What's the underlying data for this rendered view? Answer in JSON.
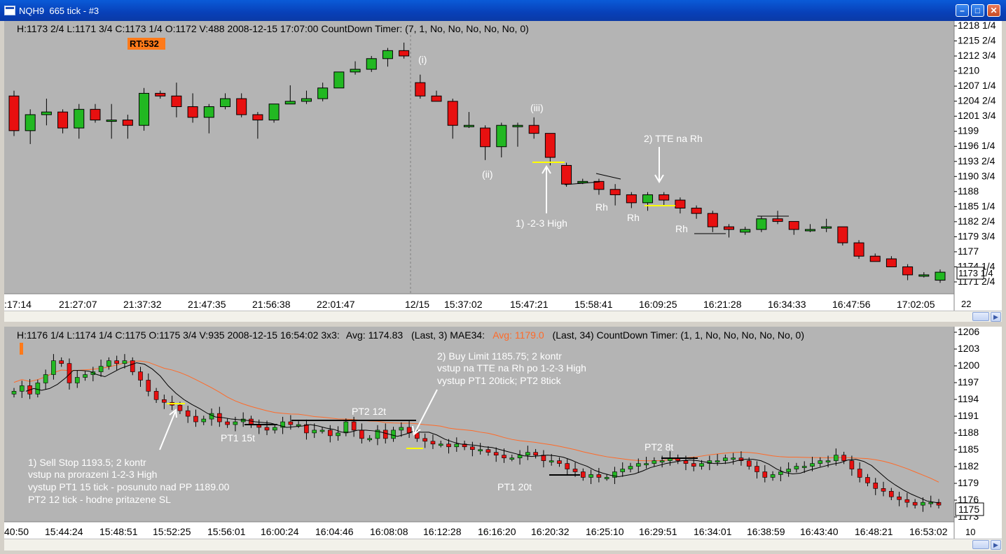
{
  "window": {
    "title": "NQH9  665 tick - #3",
    "buttons": [
      "minimize",
      "maximize",
      "close"
    ]
  },
  "chart_data": [
    {
      "type": "candlestick",
      "header": "H:1173 2/4  L:1171 3/4  C:1173 1/4  O:1172  V:488  2008-12-15  17:07:00  CountDown Timer:   (7, 1, No, No, No, No, No, 0)",
      "badge": "RT:532",
      "price_axis": [
        "1218 1/4",
        "1215 2/4",
        "1212 3/4",
        "1210",
        "1207 1/4",
        "1204 2/4",
        "1201 3/4",
        "1199",
        "1196 1/4",
        "1193 2/4",
        "1190 3/4",
        "1188",
        "1185 1/4",
        "1182 2/4",
        "1179 3/4",
        "1177",
        "1174 1/4",
        "1171 2/4"
      ],
      "y_range": [
        1170.5,
        1219.5
      ],
      "last_price": "1173 1/4",
      "time_axis": [
        ":17:14",
        "21:27:07",
        "21:37:32",
        "21:47:35",
        "21:56:38",
        "22:01:47",
        "12/15",
        "15:37:02",
        "15:47:21",
        "15:58:41",
        "16:09:25",
        "16:21:28",
        "16:34:33",
        "16:47:56",
        "17:02:05"
      ],
      "axis_corner": "22",
      "candles": [
        [
          1206.5,
          1207.5,
          1199.0,
          1200.0
        ],
        [
          1200.0,
          1204.0,
          1197.5,
          1203.0
        ],
        [
          1203.0,
          1206.0,
          1201.0,
          1203.5
        ],
        [
          1203.5,
          1204.0,
          1199.5,
          1200.5
        ],
        [
          1200.5,
          1205.0,
          1198.5,
          1204.0
        ],
        [
          1204.0,
          1205.0,
          1201.5,
          1202.0
        ],
        [
          1202.0,
          1205.0,
          1198.5,
          1202.0
        ],
        [
          1202.0,
          1203.0,
          1198.5,
          1201.0
        ],
        [
          1201.0,
          1208.0,
          1200.0,
          1207.0
        ],
        [
          1207.0,
          1207.5,
          1206.0,
          1206.5
        ],
        [
          1206.5,
          1209.0,
          1202.5,
          1204.5
        ],
        [
          1204.5,
          1207.0,
          1201.5,
          1202.5
        ],
        [
          1202.5,
          1205.0,
          1199.5,
          1204.5
        ],
        [
          1204.5,
          1207.0,
          1204.0,
          1206.0
        ],
        [
          1206.0,
          1207.0,
          1202.5,
          1203.0
        ],
        [
          1203.0,
          1203.5,
          1198.5,
          1202.0
        ],
        [
          1202.0,
          1205.0,
          1201.5,
          1205.0
        ],
        [
          1205.0,
          1208.5,
          1205.0,
          1205.5
        ],
        [
          1205.5,
          1207.5,
          1205.0,
          1206.0
        ],
        [
          1206.0,
          1209.0,
          1205.5,
          1208.0
        ],
        [
          1208.0,
          1211.0,
          1208.0,
          1211.0
        ],
        [
          1211.0,
          1213.0,
          1210.5,
          1211.5
        ],
        [
          1211.5,
          1214.0,
          1211.0,
          1213.5
        ],
        [
          1213.5,
          1215.5,
          1212.0,
          1215.0
        ],
        [
          1215.0,
          1216.5,
          1213.5,
          1214.0
        ],
        [
          1209.0,
          1210.5,
          1206.0,
          1206.5
        ],
        [
          1206.5,
          1207.5,
          1205.5,
          1205.5
        ],
        [
          1205.5,
          1206.0,
          1198.5,
          1201.0
        ],
        [
          1201.0,
          1203.5,
          1200.5,
          1201.0
        ],
        [
          1200.5,
          1201.0,
          1194.5,
          1197.0
        ],
        [
          1197.0,
          1201.5,
          1195.0,
          1201.0
        ],
        [
          1201.0,
          1201.5,
          1197.0,
          1201.0
        ],
        [
          1201.0,
          1202.5,
          1198.5,
          1199.5
        ],
        [
          1199.5,
          1199.5,
          1193.5,
          1195.0
        ],
        [
          1193.5,
          1194.0,
          1189.5,
          1190.0
        ],
        [
          1190.5,
          1191.0,
          1190.0,
          1190.5
        ],
        [
          1190.5,
          1191.0,
          1188.0,
          1189.0
        ],
        [
          1189.0,
          1190.0,
          1186.0,
          1188.0
        ],
        [
          1188.0,
          1188.5,
          1185.5,
          1186.5
        ],
        [
          1186.5,
          1188.5,
          1185.0,
          1188.0
        ],
        [
          1188.0,
          1188.5,
          1186.0,
          1187.0
        ],
        [
          1187.0,
          1187.5,
          1184.5,
          1185.5
        ],
        [
          1185.5,
          1186.0,
          1183.5,
          1184.5
        ],
        [
          1184.5,
          1185.0,
          1181.0,
          1182.0
        ],
        [
          1182.0,
          1182.5,
          1180.0,
          1181.5
        ],
        [
          1181.0,
          1182.0,
          1180.5,
          1181.5
        ],
        [
          1181.5,
          1184.0,
          1181.0,
          1183.5
        ],
        [
          1183.5,
          1185.0,
          1182.5,
          1183.0
        ],
        [
          1183.0,
          1183.0,
          1180.5,
          1181.5
        ],
        [
          1181.5,
          1182.5,
          1181.0,
          1181.5
        ],
        [
          1182.0,
          1183.5,
          1181.0,
          1182.0
        ],
        [
          1182.0,
          1182.0,
          1178.5,
          1179.0
        ],
        [
          1179.0,
          1179.5,
          1176.0,
          1176.5
        ],
        [
          1176.5,
          1177.0,
          1175.5,
          1175.5
        ],
        [
          1176.0,
          1176.5,
          1174.5,
          1174.5
        ],
        [
          1174.5,
          1175.0,
          1172.0,
          1173.0
        ],
        [
          1173.0,
          1173.5,
          1172.5,
          1173.0
        ],
        [
          1172.0,
          1174.0,
          1171.5,
          1173.5
        ]
      ],
      "annotations": [
        "(i)",
        "(iii)",
        "(ii)",
        "2) TTE na Rh",
        "1) -2-3 High",
        "Rh",
        "Rh",
        "Rh"
      ],
      "ylim": [
        1170.5,
        1219.5
      ]
    },
    {
      "type": "candlestick",
      "header_parts": [
        "H:1176 1/4  L:1174 1/4  C:1175  O:1175 3/4  V:935  2008-12-15  16:54:02  3x3:",
        "Avg: 1174.83",
        "(Last, 3)  MAE34:",
        "Avg: 1179.0",
        "(Last, 34)  CountDown Timer:   (1, 1, No, No, No, No, No, 0)"
      ],
      "price_axis": [
        "1206",
        "1203",
        "1200",
        "1197",
        "1194",
        "1191",
        "1188",
        "1185",
        "1182",
        "1179",
        "1176",
        "1173"
      ],
      "last_price": "1175",
      "time_axis": [
        "40:50",
        "15:44:24",
        "15:48:51",
        "15:52:25",
        "15:56:01",
        "16:00:24",
        "16:04:46",
        "16:08:08",
        "16:12:28",
        "16:16:20",
        "16:20:32",
        "16:25:10",
        "16:29:51",
        "16:34:01",
        "16:38:59",
        "16:43:40",
        "16:48:21",
        "16:53:02"
      ],
      "axis_corner": "10",
      "y_range": [
        1172.5,
        1206.5
      ],
      "annotations": [
        "2) Buy Limit 1185.75; 2 kontr",
        "vstup na TTE na Rh po 1-2-3 High",
        "vystup PT1 20tick; PT2 8tick",
        "PT2 12t",
        "PT1 15t",
        "PT2 8t",
        "PT1 20t",
        "1) Sell Stop 1193.5; 2 kontr",
        "vstup na prorazeni 1-2-3 High",
        "vystup PT1 15 tick - posunuto nad PP 1189.00",
        "PT2 12 tick - hodne pritazene SL"
      ],
      "ylim": [
        1172.5,
        1206.5
      ]
    }
  ],
  "colors": {
    "background": "#b4b4b4",
    "up": "#22b822",
    "down": "#e81010",
    "ma_slow": "#ff6a28",
    "ma_fast": "#000000",
    "marker": "#ffff00",
    "badge_bg": "#ff7a1a"
  }
}
